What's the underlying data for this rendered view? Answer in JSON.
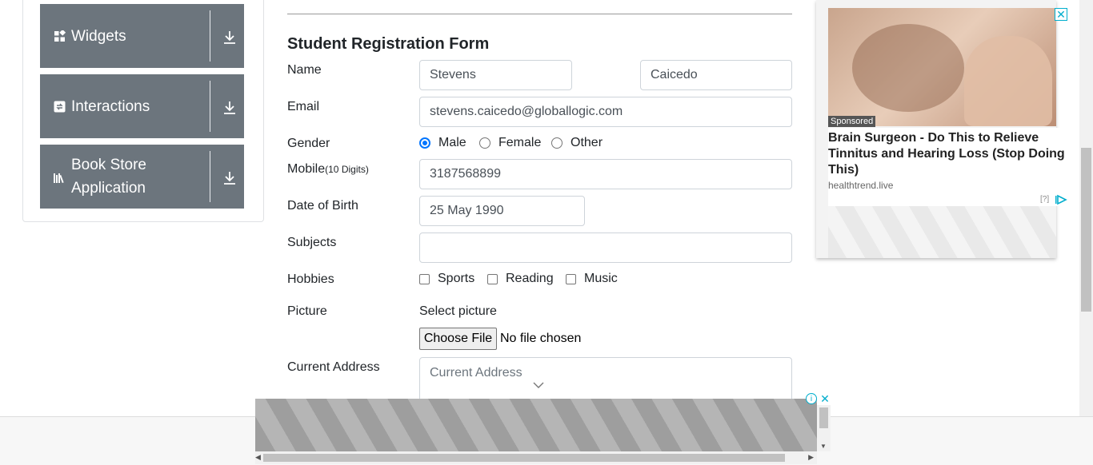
{
  "sidebar": {
    "groups": [
      {
        "label": "Widgets",
        "icon": "widgets-icon"
      },
      {
        "label": "Interactions",
        "icon": "interactions-icon"
      },
      {
        "label": "Book Store Application",
        "icon": "book-store-icon"
      }
    ]
  },
  "form": {
    "title": "Student Registration Form",
    "name": {
      "label": "Name",
      "first_value": "Stevens",
      "last_value": "Caicedo"
    },
    "email": {
      "label": "Email",
      "value": "stevens.caicedo@globallogic.com"
    },
    "gender": {
      "label": "Gender",
      "options": [
        "Male",
        "Female",
        "Other"
      ],
      "selected": "Male"
    },
    "mobile": {
      "label": "Mobile",
      "hint": "(10 Digits)",
      "value": "3187568899"
    },
    "dob": {
      "label": "Date of Birth",
      "value": "25 May 1990"
    },
    "subjects": {
      "label": "Subjects",
      "value": ""
    },
    "hobbies": {
      "label": "Hobbies",
      "options": [
        "Sports",
        "Reading",
        "Music"
      ]
    },
    "picture": {
      "label": "Picture",
      "select_text": "Select picture",
      "button": "Choose File",
      "status": "No file chosen"
    },
    "address": {
      "label": "Current Address",
      "placeholder": "Current Address"
    }
  },
  "ad_right": {
    "sponsored": "Sponsored",
    "headline": "Brain Surgeon - Do This to Relieve Tinnitus and Hearing Loss (Stop Doing This)",
    "domain": "healthtrend.live",
    "help": "[?]",
    "close": "✕"
  },
  "ad_bottom": {
    "info": "i",
    "close": "✕"
  },
  "colors": {
    "sidebar_group_bg": "#6c757d",
    "accent": "#0075ff",
    "ad_accent": "#00aecd"
  }
}
